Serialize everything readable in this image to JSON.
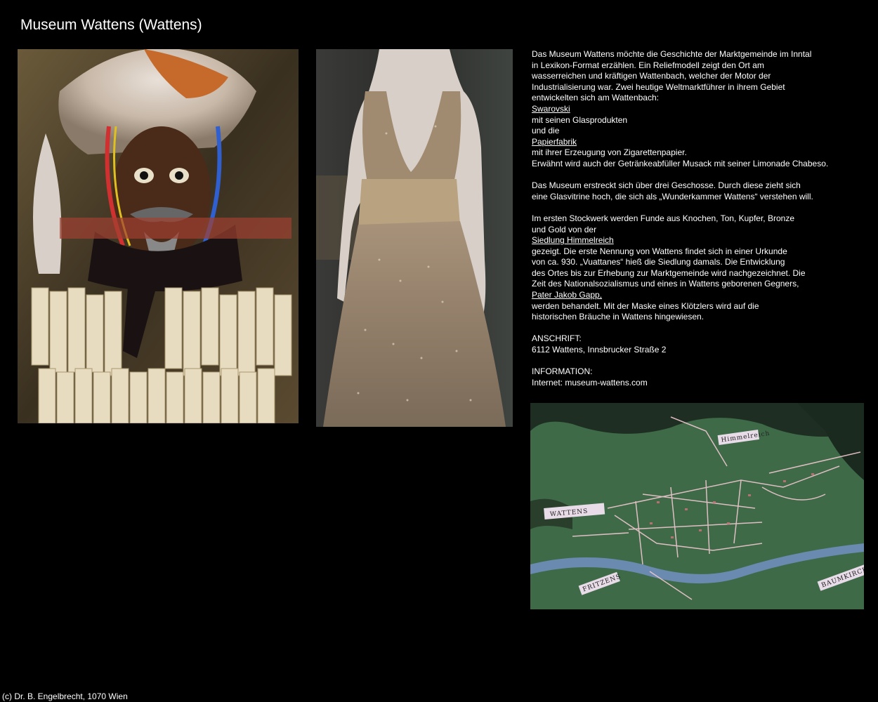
{
  "page": {
    "title": "Museum Wattens (Wattens)",
    "copyright": "(c) Dr. B. Engelbrecht, 1070 Wien"
  },
  "description": {
    "p1": [
      "Das Museum Wattens möchte die Geschichte der Marktgemeinde im Inntal",
      "in Lexikon-Format erzählen. Ein Reliefmodell zeigt den Ort am",
      "wasserreichen und kräftigen Wattenbach, welcher der Motor der",
      "Industrialisierung war. Zwei heutige Weltmarktführer in ihrem Gebiet",
      "entwickelten sich am Wattenbach:"
    ],
    "link_swarovski": "Swarovski",
    "p1b": [
      "mit seinen Glasprodukten",
      "und die"
    ],
    "link_papierfabrik": "Papierfabrik",
    "p1c": [
      "mit ihrer Erzeugung von Zigarettenpapier.",
      "Erwähnt wird auch der Getränkeabfüller Musack mit seiner Limonade Chabeso."
    ],
    "p2": [
      "Das Museum erstreckt sich über drei Geschosse. Durch diese zieht sich",
      "eine Glasvitrine hoch, die sich als „Wunderkammer Wattens“ verstehen will."
    ],
    "p3a": [
      "Im ersten Stockwerk werden Funde aus Knochen, Ton, Kupfer, Bronze",
      "und Gold von der"
    ],
    "link_himmelreich": "Siedlung Himmelreich",
    "p3b": [
      "gezeigt. Die erste Nennung von Wattens findet sich in einer Urkunde",
      "von ca. 930. „Vuattanes“ hieß die Siedlung damals. Die Entwicklung",
      "des Ortes bis zur Erhebung zur Marktgemeinde wird nachgezeichnet. Die",
      "Zeit des Nationalsozialismus und eines in Wattens geborenen Gegners,"
    ],
    "link_gapp": "Pater Jakob Gapp,",
    "p3c": [
      "werden behandelt. Mit der Maske eines Klötzlers wird auf die",
      "historischen Bräuche in Wattens hingewiesen."
    ],
    "address_label": "ANSCHRIFT:",
    "address": "6112 Wattens, Innsbrucker Straße 2",
    "info_label": "INFORMATION:",
    "info": "Internet: museum-wattens.com"
  },
  "map_labels": {
    "himmelreich": "Himmelreich",
    "wattens": "WATTENS",
    "fritzens": "FRITZENS",
    "baumkirchen": "BAUMKIRCHEN"
  }
}
